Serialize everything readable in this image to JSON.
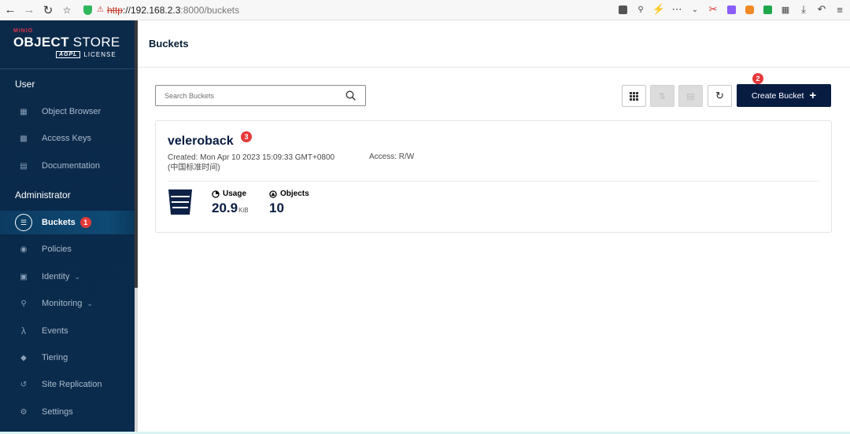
{
  "browser": {
    "url_scheme": "http",
    "url_host": "://192.168.2.3",
    "url_rest": ":8000/buckets"
  },
  "logo": {
    "small": "MINIO",
    "brand_bold": "OBJECT",
    "brand_light": " STORE",
    "agpl": "AGPL",
    "license": "LICENSE"
  },
  "sidebar": {
    "user_section": "User",
    "admin_section": "Administrator",
    "user_items": [
      {
        "label": "Object Browser",
        "icon": "object-browser-icon"
      },
      {
        "label": "Access Keys",
        "icon": "access-keys-icon"
      },
      {
        "label": "Documentation",
        "icon": "documentation-icon"
      }
    ],
    "admin_items": [
      {
        "label": "Buckets",
        "icon": "bucket-icon",
        "active": true,
        "badge": "1"
      },
      {
        "label": "Policies",
        "icon": "policies-icon"
      },
      {
        "label": "Identity",
        "icon": "identity-icon",
        "has_chevron": true
      },
      {
        "label": "Monitoring",
        "icon": "monitoring-icon",
        "has_chevron": true
      },
      {
        "label": "Events",
        "icon": "lambda-icon"
      },
      {
        "label": "Tiering",
        "icon": "tiering-icon"
      },
      {
        "label": "Site Replication",
        "icon": "replication-icon"
      },
      {
        "label": "Settings",
        "icon": "settings-icon"
      }
    ]
  },
  "main": {
    "title": "Buckets",
    "search_placeholder": "Search Buckets",
    "create_button": "Create Bucket",
    "create_badge": "2"
  },
  "bucket": {
    "name": "veleroback",
    "name_badge": "3",
    "created_line1": "Created: Mon Apr 10 2023 15:09:33 GMT+0800",
    "created_line2": "(中国标准时间)",
    "access": "Access: R/W",
    "usage_label": "Usage",
    "usage_value": "20.9",
    "usage_unit": "KiB",
    "objects_label": "Objects",
    "objects_value": "10"
  },
  "colors": {
    "sidebar_bg": "#0b2a4a",
    "primary": "#081c42",
    "badge": "#e5393b"
  }
}
